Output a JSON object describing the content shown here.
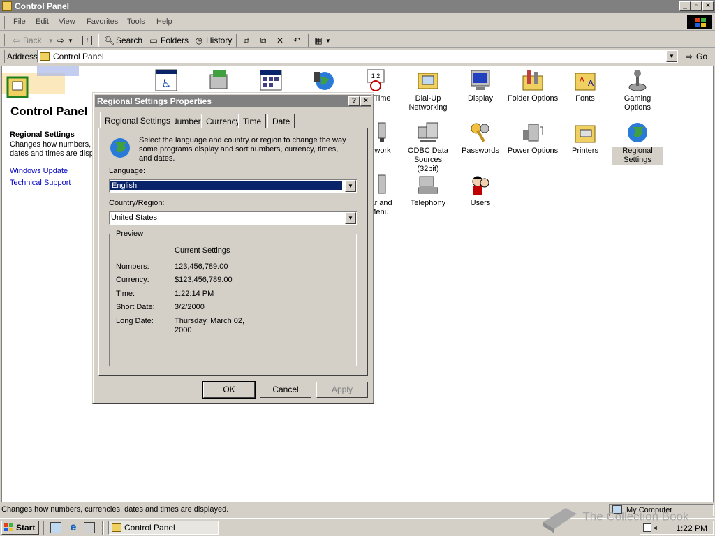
{
  "window": {
    "title": "Control Panel"
  },
  "menu": [
    "File",
    "Edit",
    "View",
    "Favorites",
    "Tools",
    "Help"
  ],
  "toolbar": {
    "back": "Back",
    "search": "Search",
    "folders": "Folders",
    "history": "History"
  },
  "address": {
    "label": "Address",
    "value": "Control Panel",
    "go": "Go"
  },
  "panel": {
    "title": "Control Panel",
    "selected_title": "Regional Settings",
    "selected_desc": "Changes how numbers, c dates and times are displ",
    "links": [
      "Windows Update",
      "Technical Support"
    ]
  },
  "icons": [
    {
      "label": "",
      "icon": "accessibility-icon"
    },
    {
      "label": "",
      "icon": "add-remove-programs-icon"
    },
    {
      "label": "",
      "icon": "administrative-tools-icon"
    },
    {
      "label": "",
      "icon": "add-new-hardware-icon"
    },
    {
      "label": "/Time",
      "icon": "date-time-icon"
    },
    {
      "label": "Dial-Up Networking",
      "icon": "dialup-networking-icon"
    },
    {
      "label": "Display",
      "icon": "display-icon"
    },
    {
      "label": "Folder Options",
      "icon": "folder-options-icon"
    },
    {
      "label": "Fonts",
      "icon": "fonts-icon"
    },
    {
      "label": "Gaming Options",
      "icon": "gaming-options-icon"
    },
    {
      "label": "work",
      "icon": "network-icon"
    },
    {
      "label": "ODBC Data Sources (32bit)",
      "icon": "odbc-icon"
    },
    {
      "label": "Passwords",
      "icon": "passwords-icon"
    },
    {
      "label": "Power Options",
      "icon": "power-options-icon"
    },
    {
      "label": "Printers",
      "icon": "printers-icon"
    },
    {
      "label": "Regional Settings",
      "icon": "regional-settings-icon"
    },
    {
      "label": "bar and Menu",
      "icon": "taskbar-icon"
    },
    {
      "label": "Telephony",
      "icon": "telephony-icon"
    },
    {
      "label": "Users",
      "icon": "users-icon"
    }
  ],
  "dialog": {
    "title": "Regional Settings Properties",
    "tabs": [
      "Regional Settings",
      "Number",
      "Currency",
      "Time",
      "Date"
    ],
    "intro": "Select the language and country or region to change the way some programs display and sort numbers, currency, times, and dates.",
    "language_label": "Language:",
    "language_value": "English",
    "country_label": "Country/Region:",
    "country_value": "United States",
    "preview_legend": "Preview",
    "preview_header": "Current Settings",
    "preview_rows": [
      {
        "label": "Numbers:",
        "value": "123,456,789.00"
      },
      {
        "label": "Currency:",
        "value": "$123,456,789.00"
      },
      {
        "label": "Time:",
        "value": "1:22:14 PM"
      },
      {
        "label": "Short Date:",
        "value": "3/2/2000"
      },
      {
        "label": "Long Date:",
        "value": "Thursday, March 02, 2000"
      }
    ],
    "buttons": {
      "ok": "OK",
      "cancel": "Cancel",
      "apply": "Apply"
    }
  },
  "status": {
    "text": "Changes how numbers, currencies, dates and times are displayed.",
    "zone": "My Computer"
  },
  "taskbar": {
    "start": "Start",
    "task": "Control Panel",
    "clock": "1:22 PM"
  },
  "watermark": "The Collection Book",
  "colors": {
    "face": "#d4d0c8",
    "titlebar_inactive": "#808080",
    "selection": "#0a246a",
    "link": "#0000c0"
  }
}
